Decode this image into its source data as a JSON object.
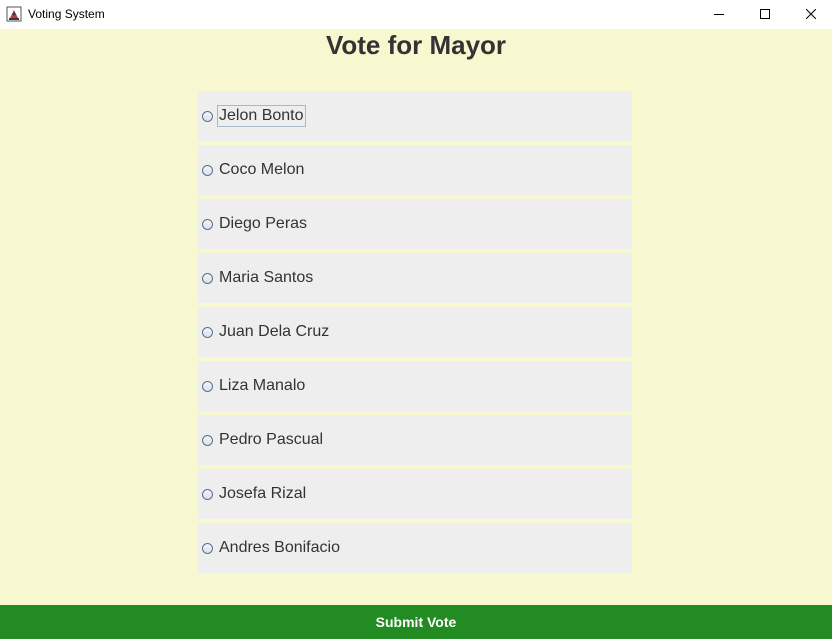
{
  "window": {
    "title": "Voting System",
    "icon": "java-app-icon",
    "controls": [
      "minimize-icon",
      "maximize-icon",
      "close-icon"
    ]
  },
  "page": {
    "title": "Vote for Mayor"
  },
  "candidates": [
    {
      "label": "Jelon Bonto",
      "selected": false,
      "focused": true
    },
    {
      "label": "Coco Melon",
      "selected": false
    },
    {
      "label": "Diego Peras",
      "selected": false
    },
    {
      "label": "Maria Santos",
      "selected": false
    },
    {
      "label": "Juan Dela Cruz",
      "selected": false
    },
    {
      "label": "Liza Manalo",
      "selected": false
    },
    {
      "label": "Pedro Pascual",
      "selected": false
    },
    {
      "label": "Josefa Rizal",
      "selected": false
    },
    {
      "label": "Andres Bonifacio",
      "selected": false
    }
  ],
  "submit": {
    "label": "Submit Vote"
  },
  "colors": {
    "background": "#f8f8d0",
    "option_bg": "#eeeeee",
    "submit_bg": "#228b22",
    "submit_text": "#ffffff",
    "title_text": "#333333"
  }
}
